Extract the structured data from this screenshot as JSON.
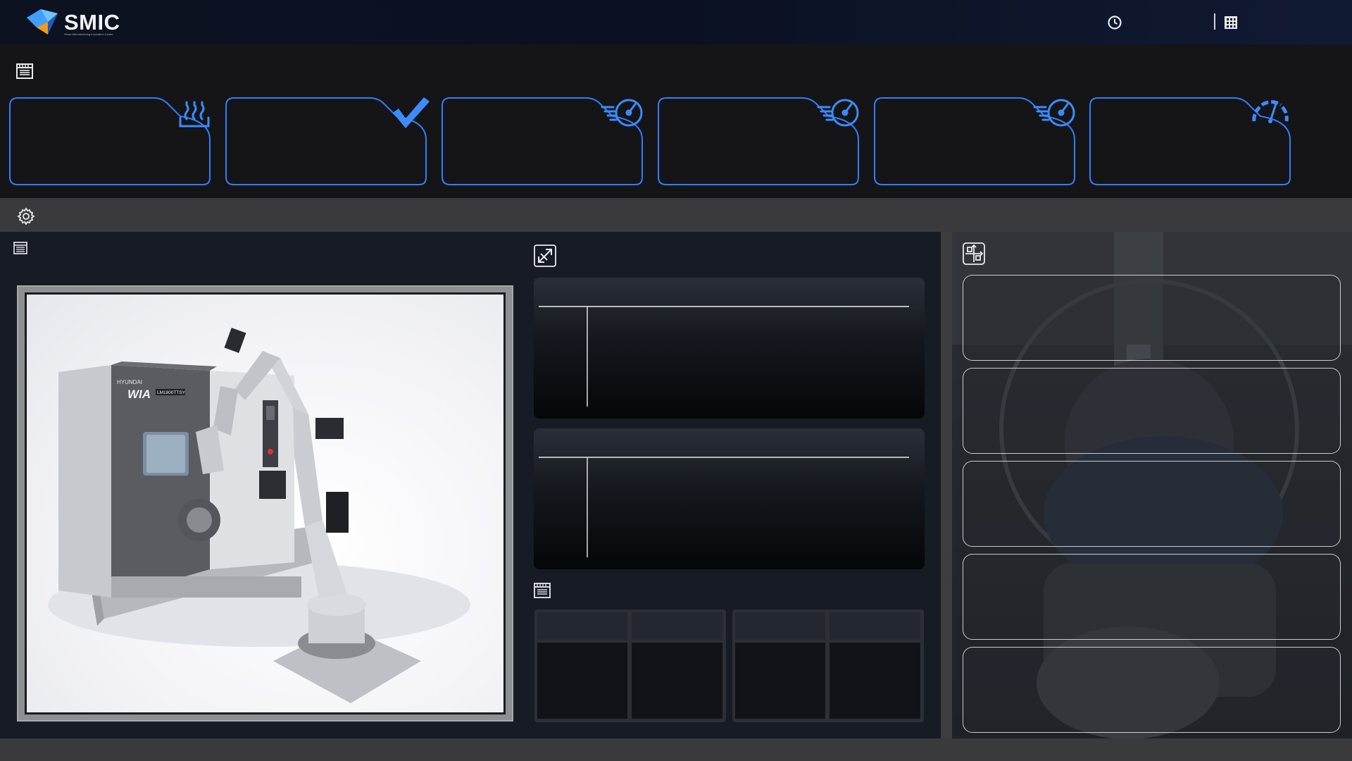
{
  "header": {
    "brand": "SMIC",
    "brand_tagline": "Smart Manufacturing Innovation Center",
    "icons": [
      "clock-icon",
      "building-icon"
    ]
  },
  "kpi_cards": [
    {
      "icon": "heat-icon"
    },
    {
      "icon": "checkmark-icon"
    },
    {
      "icon": "speed-dial-icon"
    },
    {
      "icon": "speed-dial-icon"
    },
    {
      "icon": "speed-dial-icon"
    },
    {
      "icon": "gauge-icon"
    }
  ],
  "machine_photo": {
    "cabinet_brand": "HYUNDAI",
    "cabinet_logo": "WIA",
    "cabinet_model": "LM1800TTSY"
  },
  "colors": {
    "accent": "#2f7fff",
    "header_bg": "#0d1220",
    "panel_bg": "#161b24",
    "kpi_bg": "#151517"
  }
}
